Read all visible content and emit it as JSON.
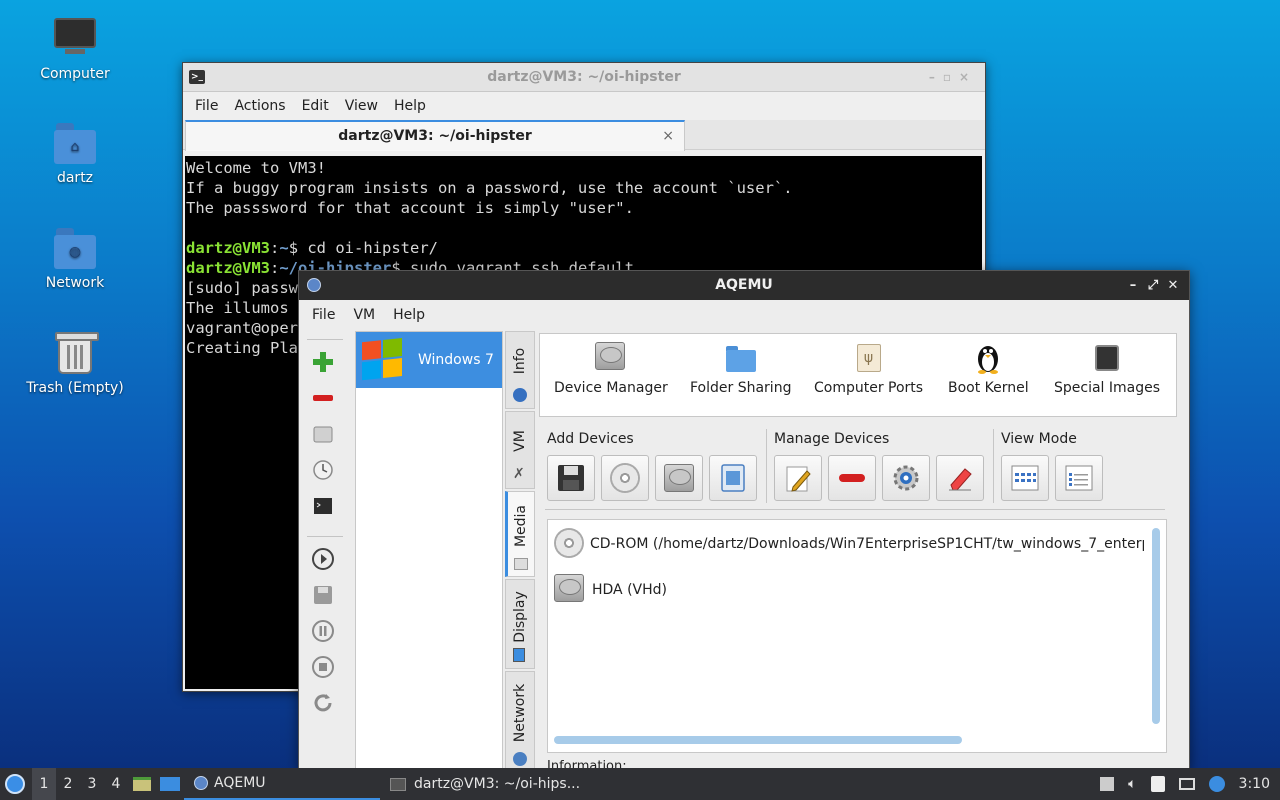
{
  "desktop": {
    "icons": [
      {
        "label": "Computer"
      },
      {
        "label": "dartz"
      },
      {
        "label": "Network"
      },
      {
        "label": "Trash (Empty)"
      }
    ]
  },
  "terminal": {
    "title": "dartz@VM3: ~/oi-hipster",
    "menu": [
      "File",
      "Actions",
      "Edit",
      "View",
      "Help"
    ],
    "tab_label": "dartz@VM3: ~/oi-hipster",
    "tab_close": "×",
    "lines": {
      "l1": "Welcome to VM3!",
      "l2": "If a buggy program insists on a password, use the account `user`.",
      "l3": "The passsword for that account is simply \"user\".",
      "p1_user": "dartz@VM3",
      "p1_sep": ":",
      "p1_path": "~",
      "p1_cmd": "$ cd oi-hipster/",
      "p2_user": "dartz@VM3",
      "p2_sep": ":",
      "p2_path": "~/oi-hipster",
      "p2_cmd": "$ sudo vagrant ssh default",
      "l6": "[sudo] passw",
      "l7": "The illumos",
      "l8": "vagrant@oper",
      "l9": "Creating Pla"
    }
  },
  "aqemu": {
    "title": "AQEMU",
    "menu": [
      "File",
      "VM",
      "Help"
    ],
    "vm_list": [
      {
        "name": "Windows 7"
      }
    ],
    "side_tabs": [
      "Info",
      "VM",
      "Media",
      "Display",
      "Network"
    ],
    "device_bar": [
      {
        "label": "Device Manager"
      },
      {
        "label": "Folder Sharing"
      },
      {
        "label": "Computer Ports"
      },
      {
        "label": "Boot Kernel"
      },
      {
        "label": "Special Images"
      }
    ],
    "groups": {
      "add": "Add Devices",
      "manage": "Manage Devices",
      "view": "View Mode"
    },
    "devices": [
      {
        "label": "CD-ROM (/home/dartz/Downloads/Win7EnterpriseSP1CHT/tw_windows_7_enterp"
      },
      {
        "label": "HDA (VHd)"
      }
    ],
    "information_label": "Information:"
  },
  "taskbar": {
    "workspaces": [
      "1",
      "2",
      "3",
      "4"
    ],
    "tasks": [
      {
        "label": "AQEMU"
      },
      {
        "label": "dartz@VM3: ~/oi-hips..."
      }
    ],
    "clock": "3:10"
  },
  "colors": {
    "accent": "#3b8de0",
    "terminal_prompt_user": "#8ae234",
    "terminal_prompt_path": "#729fcf"
  }
}
